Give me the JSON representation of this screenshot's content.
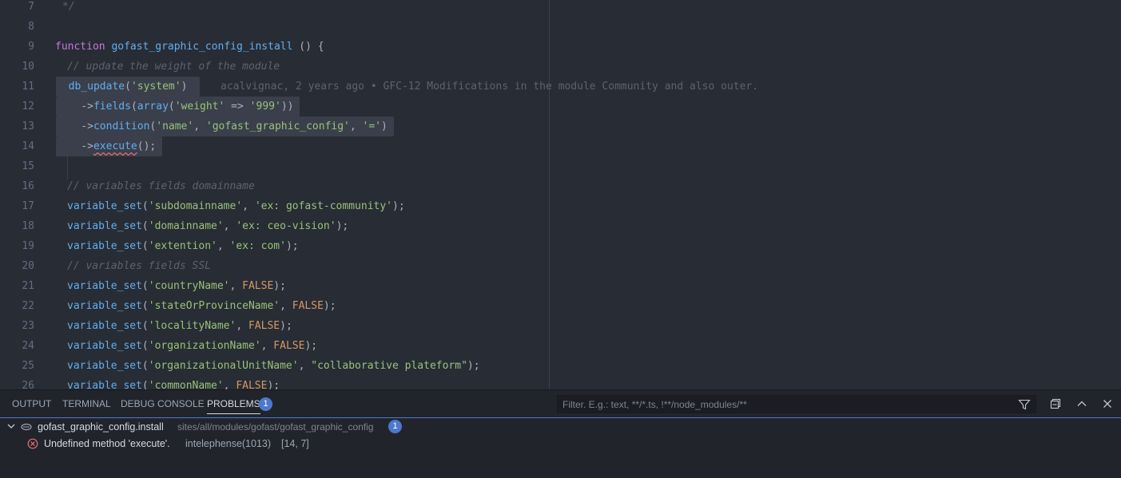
{
  "editor": {
    "lines": [
      {
        "n": "7",
        "text": "*/"
      },
      {
        "n": "8",
        "text": ""
      },
      {
        "n": "9",
        "text": "function gofast_graphic_config_install () {"
      },
      {
        "n": "10",
        "text": "// update the weight of the module"
      },
      {
        "n": "11",
        "text": "db_update('system')"
      },
      {
        "n": "12",
        "text": "->fields(array('weight' => '999'))"
      },
      {
        "n": "13",
        "text": "->condition('name', 'gofast_graphic_config', '=')"
      },
      {
        "n": "14",
        "text": "->execute();"
      },
      {
        "n": "15",
        "text": ""
      },
      {
        "n": "16",
        "text": "// variables fields domainname"
      },
      {
        "n": "17",
        "text": "variable_set('subdomainname', 'ex: gofast-community');"
      },
      {
        "n": "18",
        "text": "variable_set('domainname', 'ex: ceo-vision');"
      },
      {
        "n": "19",
        "text": "variable_set('extention', 'ex: com');"
      },
      {
        "n": "20",
        "text": "// variables fields SSL"
      },
      {
        "n": "21",
        "text": "variable_set('countryName', FALSE);"
      },
      {
        "n": "22",
        "text": "variable_set('stateOrProvinceName', FALSE);"
      },
      {
        "n": "23",
        "text": "variable_set('localityName', FALSE);"
      },
      {
        "n": "24",
        "text": "variable_set('organizationName', FALSE);"
      },
      {
        "n": "25",
        "text": "variable_set('organizationalUnitName', \"collaborative plateform\");"
      },
      {
        "n": "26",
        "text": "variable_set('commonName', FALSE);"
      }
    ],
    "blame": "acalvignac, 2 years ago • GFC-12 Modifications in the module Community and also outer."
  },
  "panel": {
    "tabs": [
      "OUTPUT",
      "TERMINAL",
      "DEBUG CONSOLE",
      "PROBLEMS"
    ],
    "problems_count": "1",
    "filter_placeholder": "Filter. E.g.: text, **/*.ts, !**/node_modules/**",
    "file": {
      "name": "gofast_graphic_config.install",
      "path": "sites/all/modules/gofast/gofast_graphic_config",
      "count": "1"
    },
    "problem": {
      "message": "Undefined method 'execute'.",
      "source": "intelephense(1013)",
      "position": "[14, 7]"
    }
  },
  "colors": {
    "editor_bg": "#282c34",
    "panel_bg": "#21252b",
    "accent": "#4d78cc",
    "error": "#e06c75"
  }
}
